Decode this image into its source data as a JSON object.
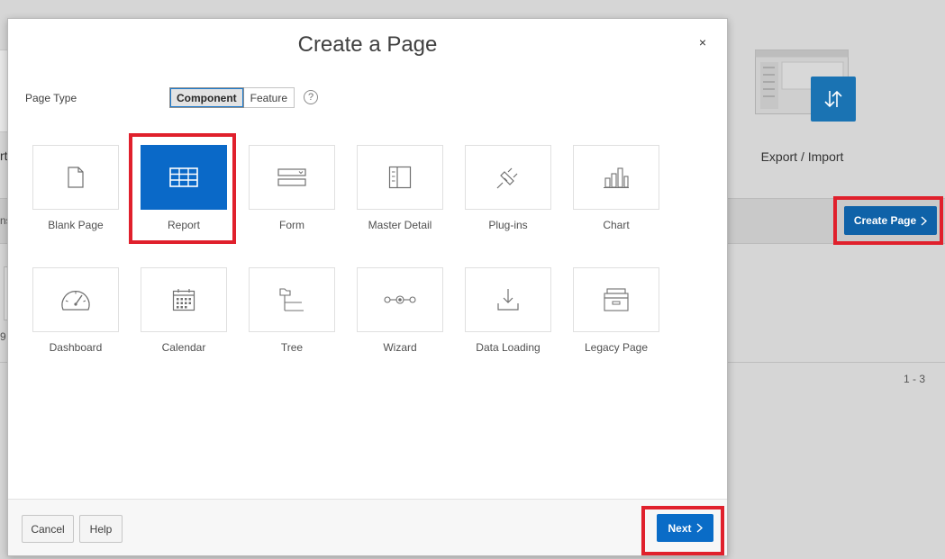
{
  "background": {
    "export_import_label": "Export / Import",
    "create_page_label": "Create Page",
    "pager": "1 - 3",
    "left_fragment_1": "rt",
    "left_fragment_2": "ns",
    "left_fragment_3": "9"
  },
  "dialog": {
    "title": "Create a Page",
    "close_symbol": "×",
    "page_type_label": "Page Type",
    "segments": [
      {
        "label": "Component",
        "active": true
      },
      {
        "label": "Feature",
        "active": false
      }
    ],
    "help_symbol": "?",
    "tiles": [
      {
        "label": "Blank Page",
        "icon": "blank-page-icon",
        "selected": false
      },
      {
        "label": "Report",
        "icon": "report-icon",
        "selected": true
      },
      {
        "label": "Form",
        "icon": "form-icon",
        "selected": false
      },
      {
        "label": "Master Detail",
        "icon": "master-detail-icon",
        "selected": false
      },
      {
        "label": "Plug-ins",
        "icon": "plug-ins-icon",
        "selected": false
      },
      {
        "label": "Chart",
        "icon": "chart-icon",
        "selected": false
      },
      {
        "label": "Dashboard",
        "icon": "dashboard-icon",
        "selected": false
      },
      {
        "label": "Calendar",
        "icon": "calendar-icon",
        "selected": false
      },
      {
        "label": "Tree",
        "icon": "tree-icon",
        "selected": false
      },
      {
        "label": "Wizard",
        "icon": "wizard-icon",
        "selected": false
      },
      {
        "label": "Data Loading",
        "icon": "data-loading-icon",
        "selected": false
      },
      {
        "label": "Legacy Page",
        "icon": "legacy-page-icon",
        "selected": false
      }
    ],
    "footer": {
      "cancel_label": "Cancel",
      "help_label": "Help",
      "next_label": "Next"
    }
  },
  "colors": {
    "accent_blue": "#0a6cc7",
    "highlight_red": "#e0202c",
    "overlay_gray": "#d6d6d6"
  }
}
